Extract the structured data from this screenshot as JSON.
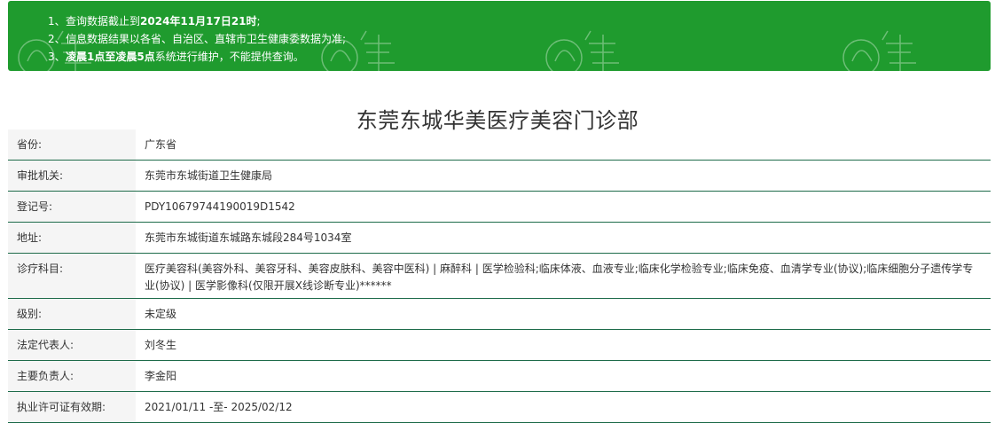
{
  "notice": {
    "items": [
      {
        "num": "1、",
        "pre": "查询数据截止到",
        "bold": "2024年11月17日21时",
        "post": ";"
      },
      {
        "num": "2、",
        "pre": "信息数据结果以各省、自治区、直辖市卫生健康委数据为准;",
        "bold": "",
        "post": ""
      },
      {
        "num": "3、",
        "pre": "",
        "bold": "凌晨1点至凌晨5点",
        "post": "系统进行维护，不能提供查询。"
      }
    ]
  },
  "title": "东莞东城华美医疗美容门诊部",
  "rows": [
    {
      "label": "省份:",
      "value": "广东省"
    },
    {
      "label": "审批机关:",
      "value": "东莞市东城街道卫生健康局"
    },
    {
      "label": "登记号:",
      "value": "PDY10679744190019D1542"
    },
    {
      "label": "地址:",
      "value": "东莞市东城街道东城路东城段284号1034室"
    },
    {
      "label": "诊疗科目:",
      "value": "医疗美容科(美容外科、美容牙科、美容皮肤科、美容中医科) | 麻醉科 | 医学检验科;临床体液、血液专业;临床化学检验专业;临床免疫、血清学专业(协议);临床细胞分子遗传学专业(协议) | 医学影像科(仅限开展X线诊断专业)******"
    },
    {
      "label": "级别:",
      "value": "未定级"
    },
    {
      "label": "法定代表人:",
      "value": "刘冬生"
    },
    {
      "label": "主要负责人:",
      "value": "李金阳"
    },
    {
      "label": "执业许可证有效期:",
      "value": "2021/01/11 -至- 2025/02/12"
    }
  ],
  "colors": {
    "notice_bg": "#1f9b2e",
    "row_border": "#1e6b4a",
    "label_bg": "#f5f5f5"
  },
  "icons": {
    "watermark": "huamei-logo-watermark"
  }
}
